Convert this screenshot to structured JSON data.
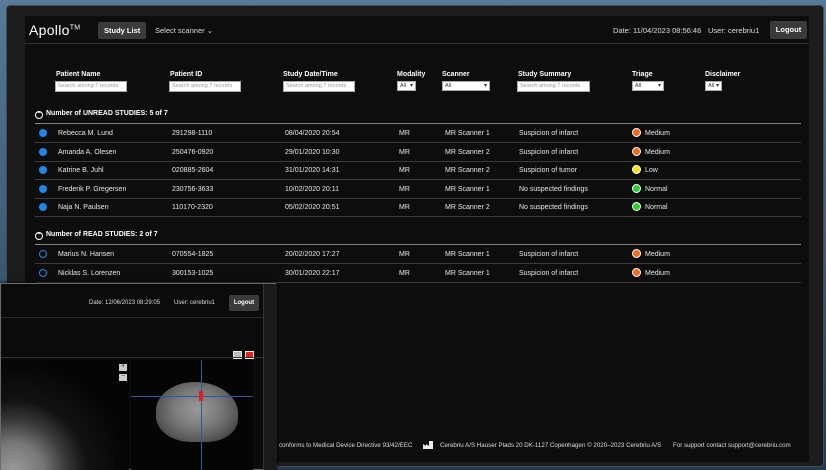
{
  "app": {
    "brand": "Apollo",
    "brand_mark": "TM"
  },
  "header": {
    "study_list_label": "Study List",
    "scanner_select_label": "Select scanner",
    "date_label": "Date: 11/04/2023 08:56:46",
    "user_label": "User: cerebriu1",
    "logout_label": "Logout"
  },
  "filters": {
    "patient_name": {
      "label": "Patient Name",
      "placeholder": "Search among 7 records"
    },
    "patient_id": {
      "label": "Patient ID",
      "placeholder": "Search among 7 records"
    },
    "study_date": {
      "label": "Study Date/Time",
      "placeholder": "Search among 7 records"
    },
    "modality": {
      "label": "Modality",
      "value": "All"
    },
    "scanner": {
      "label": "Scanner",
      "value": "All"
    },
    "study_summary": {
      "label": "Study Summary",
      "placeholder": "Search among 7 records"
    },
    "triage": {
      "label": "Triage",
      "value": "All"
    },
    "disclaimer": {
      "label": "Disclaimer",
      "value": "All"
    }
  },
  "unread": {
    "title": "Number of UNREAD STUDIES: 5 of 7",
    "rows": [
      {
        "name": "Rebecca M. Lund",
        "id": "291298-1110",
        "date": "08/04/2020 20:54",
        "modality": "MR",
        "scanner": "MR Scanner 1",
        "summary": "Suspicion of infarct",
        "triage": "Medium",
        "triage_color": "#f26b21"
      },
      {
        "name": "Amanda A. Olesen",
        "id": "250476-0920",
        "date": "29/01/2020 10:30",
        "modality": "MR",
        "scanner": "MR Scanner 2",
        "summary": "Suspicion of infarct",
        "triage": "Medium",
        "triage_color": "#f26b21"
      },
      {
        "name": "Katrine B. Juhl",
        "id": "020885-2604",
        "date": "31/01/2020 14:31",
        "modality": "MR",
        "scanner": "MR Scanner 2",
        "summary": "Suspicion of tumor",
        "triage": "Low",
        "triage_color": "#f5e11c"
      },
      {
        "name": "Frederik P. Gregersen",
        "id": "230756-3633",
        "date": "10/02/2020 20:11",
        "modality": "MR",
        "scanner": "MR Scanner 1",
        "summary": "No suspected findings",
        "triage": "Normal",
        "triage_color": "#2ecc2e"
      },
      {
        "name": "Naja N. Paulsen",
        "id": "110170-2320",
        "date": "05/02/2020 20:51",
        "modality": "MR",
        "scanner": "MR Scanner 2",
        "summary": "No suspected findings",
        "triage": "Normal",
        "triage_color": "#2ecc2e"
      }
    ]
  },
  "read": {
    "title": "Number of READ STUDIES: 2 of 7",
    "rows": [
      {
        "name": "Marius N. Hansen",
        "id": "070554-1825",
        "date": "20/02/2020 17:27",
        "modality": "MR",
        "scanner": "MR Scanner 1",
        "summary": "Suspicion of infarct",
        "triage": "Medium",
        "triage_color": "#f26b21"
      },
      {
        "name": "Nicklas S. Lorenzen",
        "id": "300153-1025",
        "date": "30/01/2020 22:17",
        "modality": "MR",
        "scanner": "MR Scanner 1",
        "summary": "Suspicion of infarct",
        "triage": "Medium",
        "triage_color": "#f26b21"
      }
    ]
  },
  "footer": {
    "directive": "conforms to Medical Device Directive 93/42/EEC",
    "company": "Cerebriu A/S Hauser Plads 20 DK-1127 Copenhagen © 2020–2023 Cerebriu A/S",
    "support": "For support contact support@cerebriu.com"
  },
  "overlay": {
    "date_label": "Date: 12/06/2023 08:29:05",
    "user_label": "User: cerebriu1",
    "logout_label": "Logout",
    "zoom_in": "+",
    "zoom_out": "−"
  }
}
